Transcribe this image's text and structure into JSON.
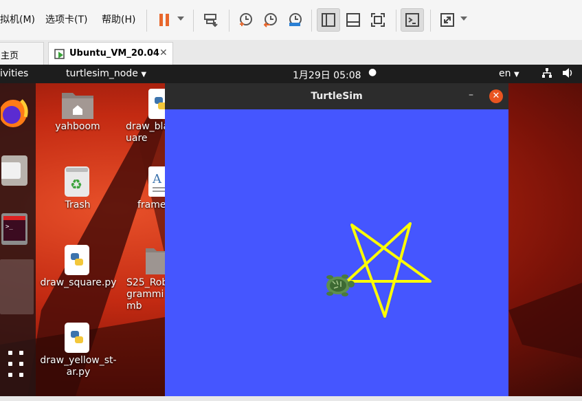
{
  "menubar": {
    "items": [
      "拟机(M)",
      "选项卡(T)",
      "帮助(H)"
    ],
    "icons": [
      "pause-icon",
      "send-keys-icon",
      "snapshot-icon",
      "revert-snapshot-icon",
      "manage-snapshots-icon",
      "view-sidebar-icon",
      "view-console-icon",
      "fullscreen-icon",
      "terminal-icon",
      "stretch-icon"
    ]
  },
  "tabs": [
    {
      "label": "主页"
    },
    {
      "label": "Ubuntu_VM_20.04"
    }
  ],
  "topbar": {
    "activities": "ivities",
    "app_menu": "turtlesim_node",
    "clock": "1月29日  05:08",
    "language": "en"
  },
  "desktop_icons": [
    {
      "label": "yahboom"
    },
    {
      "label": "draw_bla\nuare"
    },
    {
      "label": "Trash"
    },
    {
      "label": "frame"
    },
    {
      "label": "draw_square.py"
    },
    {
      "label": "S25_Rob\ngrammi\nmb"
    },
    {
      "label": "draw_yellow_st-\nar.py"
    }
  ],
  "turtlesim": {
    "title": "TurtleSim",
    "minimize": "–",
    "close": "✕",
    "background": "#4556ff",
    "pen_color": "#ffff00"
  }
}
